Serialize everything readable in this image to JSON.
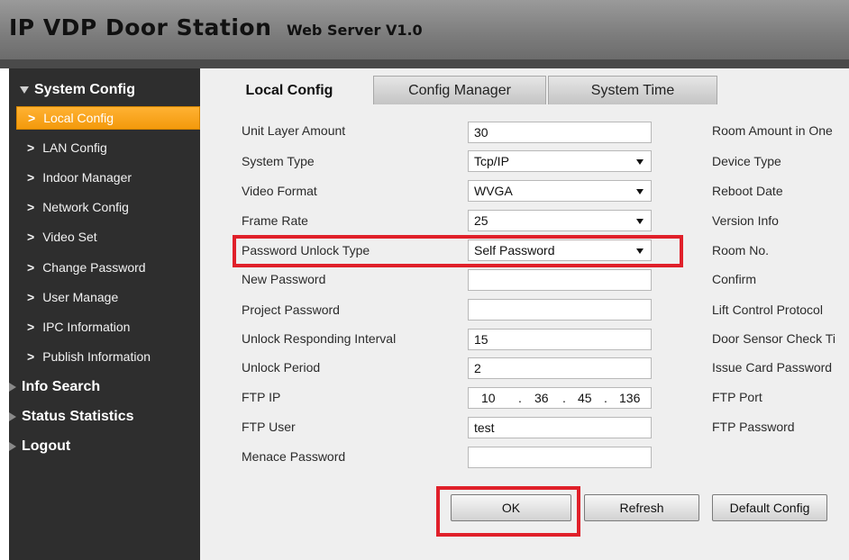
{
  "header": {
    "title": "IP VDP Door Station",
    "subtitle": "Web Server V1.0"
  },
  "sidebar": {
    "system_config": "System Config",
    "items": [
      {
        "label": "Local Config",
        "active": true
      },
      {
        "label": "LAN Config"
      },
      {
        "label": "Indoor Manager"
      },
      {
        "label": "Network Config"
      },
      {
        "label": "Video Set"
      },
      {
        "label": "Change Password"
      },
      {
        "label": "User Manage"
      },
      {
        "label": "IPC Information"
      },
      {
        "label": "Publish Information"
      }
    ],
    "info_search": "Info Search",
    "status_statistics": "Status Statistics",
    "logout": "Logout"
  },
  "tabs": [
    "Local Config",
    "Config Manager",
    "System Time"
  ],
  "form": {
    "unit_layer_amount": {
      "label": "Unit Layer Amount",
      "value": "30"
    },
    "system_type": {
      "label": "System Type",
      "value": "Tcp/IP"
    },
    "video_format": {
      "label": "Video Format",
      "value": "WVGA"
    },
    "frame_rate": {
      "label": "Frame Rate",
      "value": "25"
    },
    "password_unlock_type": {
      "label": "Password Unlock Type",
      "value": "Self Password"
    },
    "new_password": {
      "label": "New Password",
      "value": ""
    },
    "project_password": {
      "label": "Project Password",
      "value": ""
    },
    "unlock_responding_interval": {
      "label": "Unlock Responding Interval",
      "value": "15"
    },
    "unlock_period": {
      "label": "Unlock Period",
      "value": "2"
    },
    "ftp_ip": {
      "label": "FTP IP",
      "octets": [
        "10",
        "36",
        "45",
        "136"
      ]
    },
    "ftp_user": {
      "label": "FTP User",
      "value": "test"
    },
    "menace_password": {
      "label": "Menace Password",
      "value": ""
    }
  },
  "right_labels": [
    "Room Amount in One",
    "Device Type",
    "Reboot Date",
    "Version Info",
    "Room No.",
    "Confirm",
    "Lift Control Protocol",
    "Door Sensor Check Ti",
    "Issue Card Password",
    "FTP Port",
    "FTP Password"
  ],
  "buttons": {
    "ok": "OK",
    "refresh": "Refresh",
    "default_config": "Default Config"
  },
  "colors": {
    "highlight": "#e0202a",
    "active_menu": "#f39a0c"
  }
}
